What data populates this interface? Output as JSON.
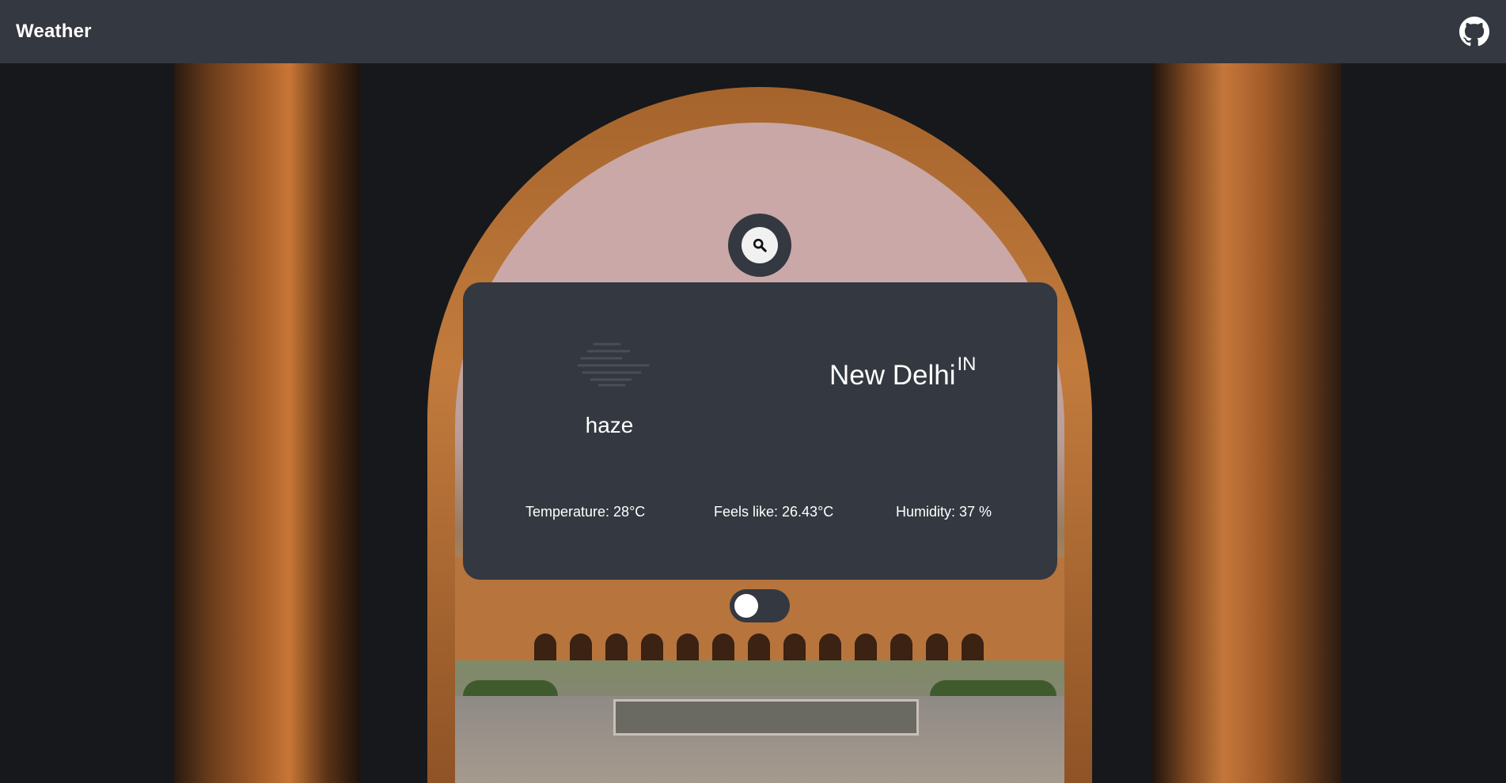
{
  "header": {
    "title": "Weather",
    "github_icon": "github-icon"
  },
  "search": {
    "icon": "search-icon"
  },
  "weather": {
    "icon": "haze-icon",
    "condition": "haze",
    "city": "New Delhi",
    "country": "IN",
    "temperature": "Temperature: 28°C",
    "feels_like": "Feels like: 26.43°C",
    "humidity": "Humidity: 37 %"
  },
  "unit_toggle": {
    "state": "off"
  },
  "colors": {
    "navbar": "#343840",
    "card": "#343840",
    "text": "#ffffff",
    "haze_icon": "#4a4e57"
  }
}
